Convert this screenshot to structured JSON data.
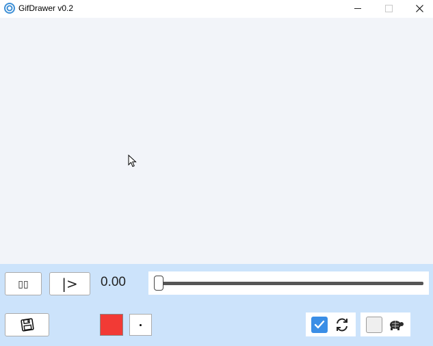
{
  "window": {
    "title": "GifDrawer v0.2"
  },
  "controls": {
    "pause_label": "▯▯",
    "step_label": "|>",
    "time_value": "0.00"
  },
  "progress": 0.0,
  "colors": {
    "brush_color": "#f23a35",
    "accent": "#3a8ee6",
    "panel": "#cce3fb",
    "canvas": "#f2f4f9"
  },
  "toggles": {
    "loop_checked": true,
    "slow_checked": false
  },
  "icons": [
    "app-icon",
    "minimize-icon",
    "maximize-icon",
    "close-icon",
    "cursor-icon",
    "save-icon",
    "loop-icon",
    "turtle-icon",
    "check-icon"
  ]
}
